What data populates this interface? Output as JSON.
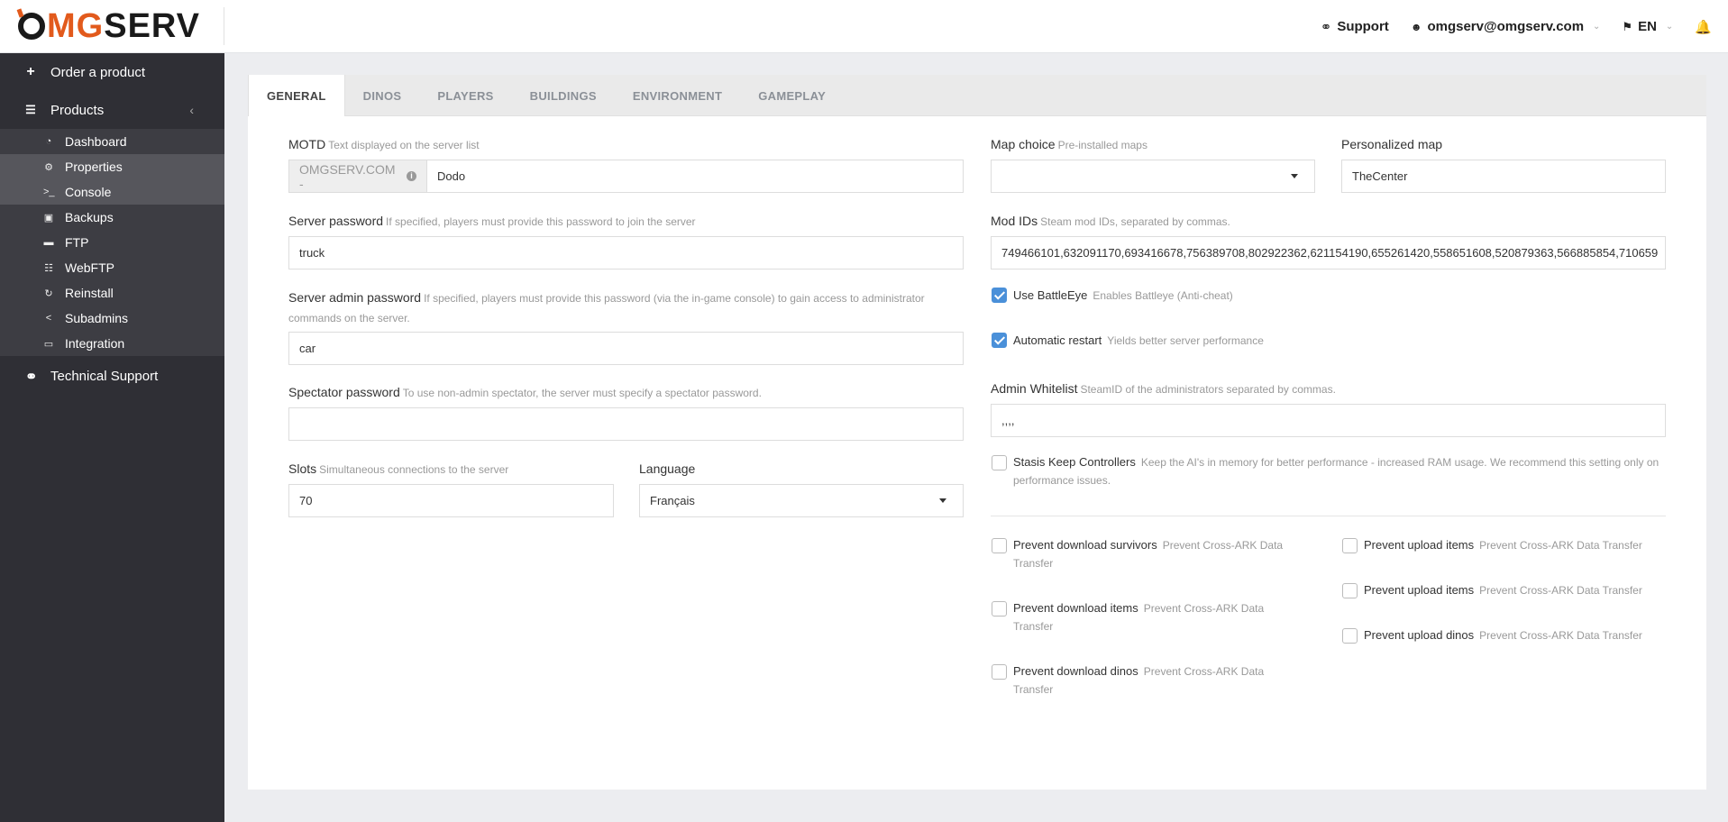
{
  "brand": {
    "logo_mg": "MG",
    "logo_serv": "SERV"
  },
  "topbar": {
    "support": "Support",
    "account": "omgserv@omgserv.com",
    "language": "EN"
  },
  "sidebar": {
    "order": "Order a product",
    "products": "Products",
    "items": [
      {
        "label": "Dashboard",
        "icon": "dashboard-icon"
      },
      {
        "label": "Properties",
        "icon": "gear-icon"
      },
      {
        "label": "Console",
        "icon": "terminal-icon"
      },
      {
        "label": "Backups",
        "icon": "save-icon"
      },
      {
        "label": "FTP",
        "icon": "folder-icon"
      },
      {
        "label": "WebFTP",
        "icon": "sitemap-icon"
      },
      {
        "label": "Reinstall",
        "icon": "refresh-icon"
      },
      {
        "label": "Subadmins",
        "icon": "share-icon"
      },
      {
        "label": "Integration",
        "icon": "monitor-icon"
      }
    ],
    "support": "Technical Support"
  },
  "tabs": [
    "GENERAL",
    "DINOS",
    "PLAYERS",
    "BUILDINGS",
    "ENVIRONMENT",
    "GAMEPLAY"
  ],
  "form": {
    "motd": {
      "label": "MOTD",
      "hint": "Text displayed on the server list",
      "prefix": "OMGSERV.COM -",
      "value": "Dodo"
    },
    "server_password": {
      "label": "Server password",
      "hint": "If specified, players must provide this password to join the server",
      "value": "truck"
    },
    "admin_password": {
      "label": "Server admin password",
      "hint": "If specified, players must provide this password (via the in-game console) to gain access to administrator commands on the server.",
      "value": "car"
    },
    "spectator_password": {
      "label": "Spectator password",
      "hint": "To use non-admin spectator, the server must specify a spectator password.",
      "value": ""
    },
    "slots": {
      "label": "Slots",
      "hint": "Simultaneous connections to the server",
      "value": "70"
    },
    "language": {
      "label": "Language",
      "value": "Français"
    },
    "map_choice": {
      "label": "Map choice",
      "hint": "Pre-installed maps",
      "value": ""
    },
    "personalized_map": {
      "label": "Personalized map",
      "value": "TheCenter"
    },
    "mod_ids": {
      "label": "Mod IDs",
      "hint": "Steam mod IDs, separated by commas.",
      "value": "749466101,632091170,693416678,756389708,802922362,621154190,655261420,558651608,520879363,566885854,710659"
    },
    "battleye": {
      "label": "Use BattleEye",
      "hint": "Enables Battleye (Anti-cheat)",
      "checked": true
    },
    "auto_restart": {
      "label": "Automatic restart",
      "hint": "Yields better server performance",
      "checked": true
    },
    "admin_whitelist": {
      "label": "Admin Whitelist",
      "hint": "SteamID of the administrators separated by commas.",
      "value": ",,,,"
    },
    "stasis": {
      "label": "Stasis Keep Controllers",
      "hint": "Keep the AI's in memory for better performance - increased RAM usage. We recommend this setting only on performance issues.",
      "checked": false
    },
    "prevent_download_survivors": {
      "label": "Prevent download survivors",
      "hint": "Prevent Cross-ARK Data Transfer",
      "checked": false
    },
    "prevent_download_items": {
      "label": "Prevent download items",
      "hint": "Prevent Cross-ARK Data Transfer",
      "checked": false
    },
    "prevent_download_dinos": {
      "label": "Prevent download dinos",
      "hint": "Prevent Cross-ARK Data Transfer",
      "checked": false
    },
    "prevent_upload_items_1": {
      "label": "Prevent upload items",
      "hint": "Prevent Cross-ARK Data Transfer",
      "checked": false
    },
    "prevent_upload_items_2": {
      "label": "Prevent upload items",
      "hint": "Prevent Cross-ARK Data Transfer",
      "checked": false
    },
    "prevent_upload_dinos": {
      "label": "Prevent upload dinos",
      "hint": "Prevent Cross-ARK Data Transfer",
      "checked": false
    }
  },
  "colors": {
    "accent": "#e25a1c",
    "sidebar": "#2f2f35",
    "checkbox": "#4a90d9"
  }
}
